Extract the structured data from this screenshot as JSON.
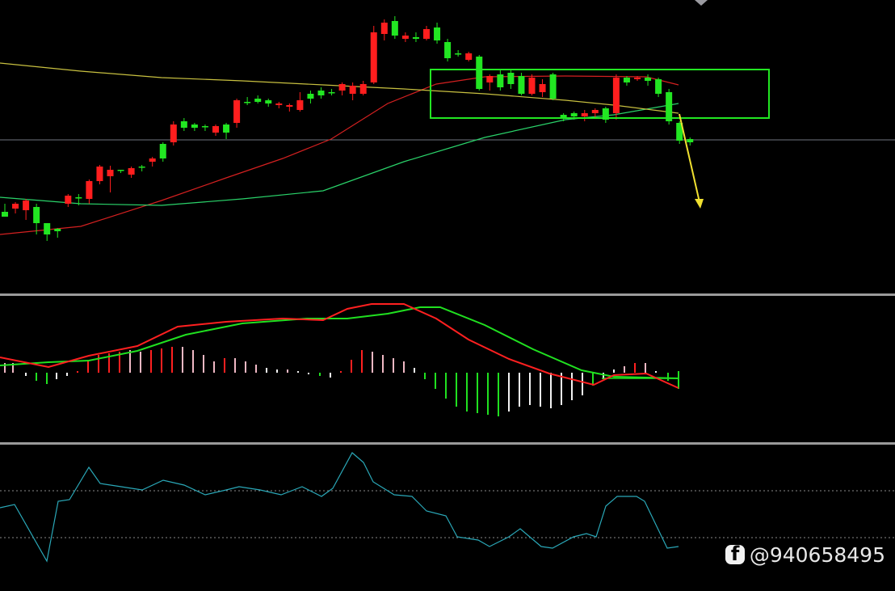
{
  "watermark": {
    "handle": "@940658495",
    "icon": "facebook-icon"
  },
  "colors": {
    "up": "#ff1e1e",
    "down": "#22e622",
    "ma_fast": "#d42020",
    "ma_mid": "#2ad36a",
    "ma_slow": "#c8c040",
    "box": "#22e622",
    "arrow": "#f0e030",
    "hline": "#6f7580",
    "separator": "#9a9a9a",
    "dif": "#ff2020",
    "dea": "#20e020",
    "hist_white": "#f2f2f2",
    "hist_pink": "#f0b8c4",
    "osc": "#2aa8b8",
    "ref": "#8a8a8a"
  },
  "chart_data": [
    {
      "type": "candlestick",
      "series": [
        {
          "name": "candles",
          "values": [
            [
              262,
              268,
              252,
              262
            ],
            [
              258,
              252,
              250,
              264
            ],
            [
              260,
              248,
              246,
              272
            ],
            [
              256,
              276,
              252,
              290
            ],
            [
              276,
              290,
              288,
              298
            ],
            [
              283,
              286,
              282,
              294
            ],
            [
              252,
              242,
              240,
              256
            ],
            [
              244,
              244,
              240,
              254
            ],
            [
              246,
              224,
              222,
              252
            ],
            [
              224,
              206,
              204,
              228
            ],
            [
              218,
              210,
              205,
              238
            ],
            [
              210,
              210,
              210,
              214
            ],
            [
              216,
              208,
              206,
              220
            ],
            [
              206,
              206,
              204,
              212
            ],
            [
              200,
              196,
              194,
              206
            ],
            [
              178,
              196,
              176,
              200
            ],
            [
              176,
              154,
              150,
              180
            ],
            [
              150,
              158,
              146,
              162
            ],
            [
              154,
              158,
              152,
              162
            ],
            [
              156,
              156,
              154,
              162
            ],
            [
              164,
              156,
              154,
              168
            ],
            [
              154,
              164,
              152,
              172
            ],
            [
              152,
              124,
              122,
              158
            ],
            [
              126,
              126,
              120,
              130
            ],
            [
              122,
              126,
              118,
              128
            ],
            [
              124,
              128,
              122,
              132
            ],
            [
              130,
              128,
              126,
              134
            ],
            [
              132,
              130,
              128,
              138
            ],
            [
              136,
              124,
              114,
              138
            ],
            [
              116,
              122,
              112,
              128
            ],
            [
              112,
              118,
              108,
              122
            ],
            [
              114,
              114,
              110,
              118
            ],
            [
              112,
              104,
              102,
              118
            ],
            [
              116,
              106,
              102,
              124
            ],
            [
              116,
              104,
              100,
              118
            ],
            [
              102,
              40,
              32,
              104
            ],
            [
              42,
              28,
              24,
              50
            ],
            [
              26,
              44,
              20,
              48
            ],
            [
              48,
              44,
              40,
              52
            ],
            [
              46,
              48,
              40,
              52
            ],
            [
              48,
              36,
              32,
              50
            ],
            [
              34,
              50,
              28,
              54
            ],
            [
              52,
              72,
              48,
              76
            ],
            [
              66,
              66,
              62,
              70
            ],
            [
              74,
              66,
              64,
              76
            ],
            [
              70,
              110,
              68,
              112
            ],
            [
              102,
              94,
              92,
              112
            ],
            [
              92,
              108,
              86,
              112
            ],
            [
              90,
              104,
              86,
              110
            ],
            [
              94,
              116,
              90,
              118
            ],
            [
              116,
              96,
              92,
              118
            ],
            [
              114,
              104,
              98,
              120
            ],
            [
              92,
              122,
              90,
              124
            ],
            [
              142,
              146,
              140,
              150
            ],
            [
              140,
              144,
              138,
              148
            ],
            [
              144,
              140,
              136,
              150
            ],
            [
              140,
              136,
              134,
              146
            ],
            [
              134,
              148,
              132,
              152
            ],
            [
              140,
              96,
              92,
              148
            ],
            [
              96,
              102,
              94,
              106
            ],
            [
              98,
              96,
              94,
              100
            ],
            [
              96,
              100,
              92,
              106
            ],
            [
              98,
              116,
              96,
              120
            ],
            [
              114,
              150,
              110,
              154
            ],
            [
              152,
              174,
              150,
              178
            ],
            [
              172,
              176,
              170,
              180
            ]
          ]
        },
        {
          "name": "ma-fast",
          "values": [
            [
              0,
              290
            ],
            [
              100,
              280
            ],
            [
              200,
              248
            ],
            [
              280,
              220
            ],
            [
              350,
              196
            ],
            [
              410,
              172
            ],
            [
              480,
              128
            ],
            [
              540,
              104
            ],
            [
              600,
              95
            ],
            [
              700,
              94
            ],
            [
              800,
              95
            ],
            [
              840,
              105
            ]
          ]
        },
        {
          "name": "ma-mid",
          "values": [
            [
              0,
              244
            ],
            [
              100,
              252
            ],
            [
              200,
              254
            ],
            [
              300,
              246
            ],
            [
              400,
              236
            ],
            [
              500,
              200
            ],
            [
              600,
              170
            ],
            [
              700,
              148
            ],
            [
              760,
              142
            ],
            [
              840,
              128
            ]
          ]
        },
        {
          "name": "ma-slow",
          "values": [
            [
              0,
              78
            ],
            [
              100,
              88
            ],
            [
              200,
              96
            ],
            [
              300,
              100
            ],
            [
              400,
              105
            ],
            [
              500,
              110
            ],
            [
              600,
              116
            ],
            [
              700,
              124
            ],
            [
              760,
              130
            ],
            [
              840,
              140
            ]
          ]
        }
      ],
      "reference_line": 173
    },
    {
      "type": "macd",
      "histogram": [
        [
          6,
          12,
          "pink"
        ],
        [
          16,
          12,
          "pink"
        ],
        [
          32,
          -4,
          "white"
        ],
        [
          45,
          -10,
          "green"
        ],
        [
          58,
          -14,
          "green"
        ],
        [
          70,
          -8,
          "white"
        ],
        [
          83,
          -4,
          "white"
        ],
        [
          96,
          2,
          "red"
        ],
        [
          109,
          16,
          "red"
        ],
        [
          122,
          22,
          "red"
        ],
        [
          135,
          24,
          "red"
        ],
        [
          148,
          26,
          "red"
        ],
        [
          161,
          28,
          "pink"
        ],
        [
          174,
          26,
          "pink"
        ],
        [
          187,
          28,
          "red"
        ],
        [
          200,
          30,
          "red"
        ],
        [
          213,
          32,
          "red"
        ],
        [
          226,
          32,
          "pink"
        ],
        [
          239,
          28,
          "pink"
        ],
        [
          252,
          22,
          "pink"
        ],
        [
          265,
          14,
          "pink"
        ],
        [
          278,
          18,
          "red"
        ],
        [
          291,
          18,
          "pink"
        ],
        [
          304,
          14,
          "pink"
        ],
        [
          317,
          10,
          "pink"
        ],
        [
          330,
          6,
          "white"
        ],
        [
          343,
          4,
          "white"
        ],
        [
          356,
          4,
          "pink"
        ],
        [
          369,
          2,
          "white"
        ],
        [
          382,
          -2,
          "white"
        ],
        [
          396,
          -4,
          "green"
        ],
        [
          409,
          -6,
          "white"
        ],
        [
          422,
          2,
          "red"
        ],
        [
          435,
          16,
          "red"
        ],
        [
          448,
          28,
          "red"
        ],
        [
          461,
          26,
          "pink"
        ],
        [
          474,
          22,
          "pink"
        ],
        [
          487,
          18,
          "pink"
        ],
        [
          500,
          14,
          "pink"
        ],
        [
          513,
          6,
          "white"
        ],
        [
          526,
          -8,
          "green"
        ],
        [
          539,
          -20,
          "green"
        ],
        [
          552,
          -32,
          "green"
        ],
        [
          565,
          -42,
          "green"
        ],
        [
          578,
          -48,
          "green"
        ],
        [
          591,
          -50,
          "green"
        ],
        [
          604,
          -52,
          "green"
        ],
        [
          617,
          -54,
          "green"
        ],
        [
          630,
          -48,
          "white"
        ],
        [
          643,
          -42,
          "white"
        ],
        [
          656,
          -40,
          "white"
        ],
        [
          669,
          -42,
          "white"
        ],
        [
          682,
          -44,
          "white"
        ],
        [
          695,
          -40,
          "white"
        ],
        [
          708,
          -34,
          "white"
        ],
        [
          721,
          -28,
          "white"
        ],
        [
          734,
          -16,
          "green"
        ],
        [
          747,
          -8,
          "white"
        ],
        [
          760,
          4,
          "white"
        ],
        [
          773,
          8,
          "pink"
        ],
        [
          786,
          12,
          "red"
        ],
        [
          799,
          12,
          "pink"
        ],
        [
          812,
          2,
          "white"
        ],
        [
          827,
          -10,
          "green"
        ],
        [
          840,
          -10,
          "green"
        ]
      ],
      "dif": [
        [
          0,
          442
        ],
        [
          60,
          454
        ],
        [
          110,
          440
        ],
        [
          170,
          428
        ],
        [
          220,
          404
        ],
        [
          280,
          398
        ],
        [
          350,
          394
        ],
        [
          400,
          396
        ],
        [
          430,
          382
        ],
        [
          460,
          376
        ],
        [
          500,
          376
        ],
        [
          540,
          394
        ],
        [
          580,
          420
        ],
        [
          630,
          444
        ],
        [
          680,
          462
        ],
        [
          735,
          476
        ],
        [
          760,
          464
        ],
        [
          800,
          462
        ],
        [
          840,
          480
        ]
      ],
      "dea": [
        [
          0,
          452
        ],
        [
          60,
          448
        ],
        [
          110,
          446
        ],
        [
          170,
          434
        ],
        [
          230,
          414
        ],
        [
          300,
          400
        ],
        [
          380,
          394
        ],
        [
          430,
          394
        ],
        [
          480,
          388
        ],
        [
          520,
          380
        ],
        [
          545,
          380
        ],
        [
          600,
          402
        ],
        [
          660,
          432
        ],
        [
          720,
          458
        ],
        [
          760,
          466
        ],
        [
          840,
          468
        ]
      ],
      "zero_line": 461
    },
    {
      "type": "line",
      "series": [
        {
          "values": [
            [
              0,
              628
            ],
            [
              18,
              624
            ],
            [
              58,
              694
            ],
            [
              72,
              620
            ],
            [
              86,
              618
            ],
            [
              110,
              578
            ],
            [
              124,
              598
            ],
            [
              150,
              602
            ],
            [
              176,
              606
            ],
            [
              202,
              594
            ],
            [
              228,
              600
            ],
            [
              254,
              612
            ],
            [
              280,
              606
            ],
            [
              296,
              602
            ],
            [
              322,
              606
            ],
            [
              348,
              612
            ],
            [
              374,
              602
            ],
            [
              398,
              614
            ],
            [
              412,
              604
            ],
            [
              436,
              560
            ],
            [
              450,
              572
            ],
            [
              462,
              596
            ],
            [
              488,
              612
            ],
            [
              510,
              614
            ],
            [
              528,
              632
            ],
            [
              552,
              638
            ],
            [
              566,
              664
            ],
            [
              592,
              668
            ],
            [
              606,
              676
            ],
            [
              630,
              664
            ],
            [
              644,
              654
            ],
            [
              670,
              676
            ],
            [
              684,
              678
            ],
            [
              710,
              664
            ],
            [
              726,
              660
            ],
            [
              738,
              664
            ],
            [
              750,
              626
            ],
            [
              764,
              614
            ],
            [
              788,
              614
            ],
            [
              798,
              620
            ],
            [
              826,
              678
            ],
            [
              840,
              676
            ]
          ]
        }
      ],
      "reference_lines": [
        607,
        665
      ]
    }
  ]
}
